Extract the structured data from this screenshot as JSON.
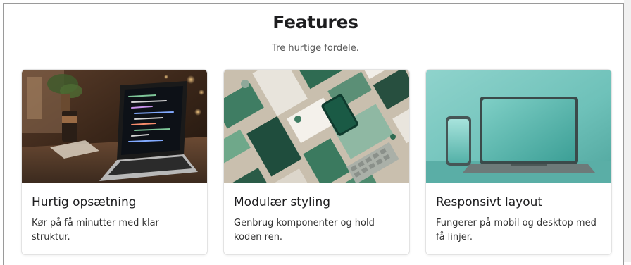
{
  "section": {
    "title": "Features",
    "subtitle": "Tre hurtige fordele."
  },
  "cards": [
    {
      "title": "Hurtig opsætning",
      "text": "Kør på få minutter med klar struktur.",
      "image": "laptop-code-on-desk-photo"
    },
    {
      "title": "Modulær styling",
      "text": "Genbrug komponenter og hold koden ren.",
      "image": "green-stationery-flatlay-photo"
    },
    {
      "title": "Responsivt layout",
      "text": "Fungerer på mobil og desktop med få linjer.",
      "image": "laptop-and-phone-on-teal-photo"
    }
  ],
  "colors": {
    "heading": "#1d1d1f",
    "subtitle": "#5a5a5a",
    "card_border": "#e3e3e3",
    "teal_accent": "#5fb3ad",
    "sage_green": "#3f7d63"
  }
}
